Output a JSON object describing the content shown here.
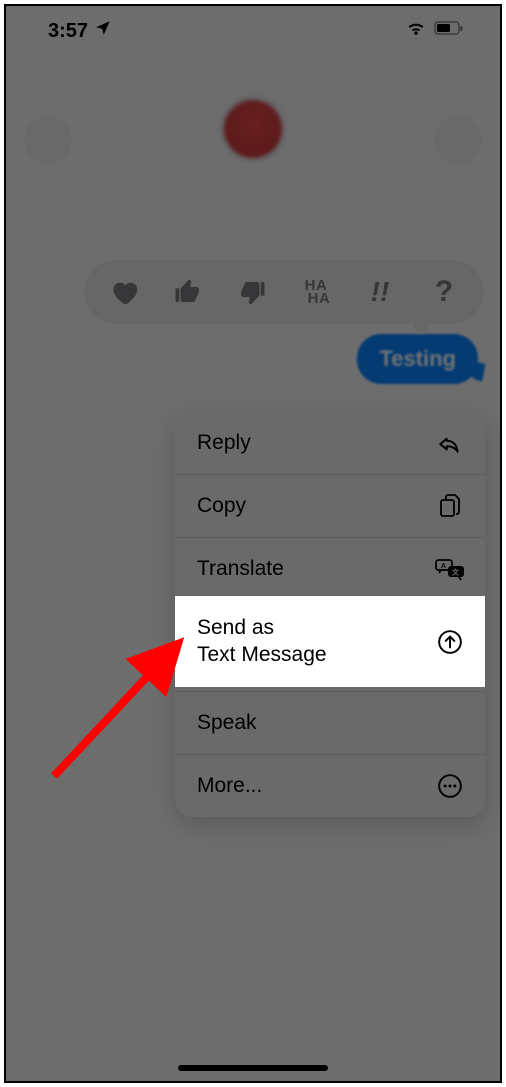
{
  "status": {
    "time": "3:57",
    "location_icon": "location-arrow",
    "wifi": true,
    "battery_level": 55
  },
  "message": {
    "text": "Testing"
  },
  "reactions": [
    {
      "name": "heart",
      "label": "Love"
    },
    {
      "name": "thumbs-up",
      "label": "Like"
    },
    {
      "name": "thumbs-down",
      "label": "Dislike"
    },
    {
      "name": "haha",
      "label": "Laugh"
    },
    {
      "name": "exclaim",
      "label": "Emphasize"
    },
    {
      "name": "question",
      "label": "Question"
    }
  ],
  "menu": {
    "items": [
      {
        "label": "Reply",
        "icon": "reply"
      },
      {
        "label": "Copy",
        "icon": "copy"
      },
      {
        "label": "Translate",
        "icon": "translate"
      },
      {
        "label": "Send as\nText Message",
        "icon": "send-up",
        "highlighted": true
      },
      {
        "label": "Speak",
        "icon": "speak"
      },
      {
        "label": "More...",
        "icon": "more"
      }
    ]
  }
}
